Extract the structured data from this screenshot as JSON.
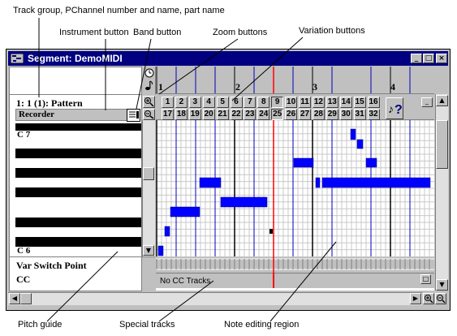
{
  "callouts": {
    "track_group": "Track group, PChannel number and name, part name",
    "instrument_button": "Instrument button",
    "band_button": "Band  button",
    "zoom_buttons": "Zoom buttons",
    "variation_buttons": "Variation buttons",
    "pitch_guide": "Pitch guide",
    "special_tracks": "Special tracks",
    "note_editing_region": "Note editing region"
  },
  "window": {
    "title": "Segment: DemoMIDI",
    "minimize": "_",
    "maximize": "□",
    "close": "×"
  },
  "part": {
    "header": "1: 1 (1): Pattern",
    "instrument": "Recorder",
    "pitch_top": "C  7",
    "pitch_bottom": "C  6",
    "var_switch_point": "Var Switch Point",
    "cc": "CC"
  },
  "ruler": {
    "measures": [
      "1",
      "2",
      "3",
      "4"
    ]
  },
  "variations": {
    "row1": [
      "1",
      "2",
      "3",
      "4",
      "5",
      "6",
      "7",
      "8",
      "9",
      "10",
      "11",
      "12",
      "13",
      "14",
      "15",
      "16"
    ],
    "row2": [
      "17",
      "18",
      "19",
      "20",
      "21",
      "22",
      "23",
      "24",
      "25",
      "26",
      "27",
      "28",
      "29",
      "30",
      "31",
      "32"
    ],
    "help_label": "?"
  },
  "cc_track": {
    "label": "No CC Tracks"
  },
  "icons": [
    "segment-window-icon",
    "clock-icon",
    "note-icon",
    "zoom-in-icon",
    "zoom-out-icon",
    "band-icon",
    "variation-help-icon",
    "scroll-up-icon",
    "scroll-down-icon",
    "scroll-left-icon",
    "scroll-right-icon"
  ],
  "colors": {
    "title_bar": "#000080",
    "notes": "#0000ff",
    "play_marker": "#ff0000",
    "window_face": "#c0c0c0"
  }
}
